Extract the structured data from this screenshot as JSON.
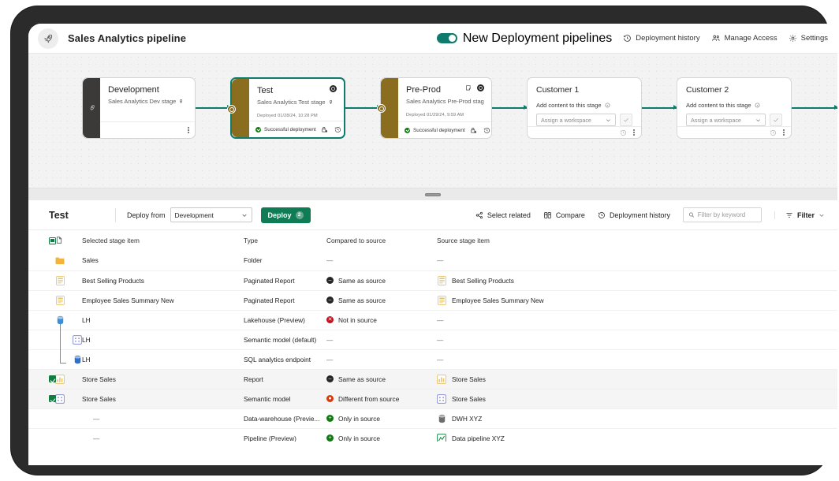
{
  "appbar": {
    "title": "Sales Analytics pipeline",
    "logo_icon": "rocket-icon",
    "toggle_label": "New Deployment pipelines",
    "toggle_on": true,
    "items": [
      {
        "label": "Deployment history",
        "icon": "history-icon"
      },
      {
        "label": "Manage Access",
        "icon": "people-icon"
      },
      {
        "label": "Settings",
        "icon": "gear-icon"
      }
    ]
  },
  "pipeline": {
    "stages": [
      {
        "name": "Development",
        "workspace": "Sales Analytics Dev stage",
        "side_color": "#3b3a39",
        "type": "deployed-plain",
        "kebab": "more-options-icon"
      },
      {
        "name": "Test",
        "workspace": "Sales Analytics Test stage",
        "side_color": "#8a6d1f",
        "type": "deployed",
        "deployed": "Deployed 01/28/24, 10:28 PM",
        "status": "Successful deployment",
        "selected": true
      },
      {
        "name": "Pre-Prod",
        "workspace": "Sales Analytics Pre-Prod stage",
        "side_color": "#8a6d1f",
        "type": "deployed",
        "deployed": "Deployed 01/29/24, 9:59 AM",
        "status": "Successful deployment",
        "selected": false
      },
      {
        "name": "Customer 1",
        "type": "empty",
        "add_label": "Add content to this stage",
        "workspace_placeholder": "Assign a workspace"
      },
      {
        "name": "Customer 2",
        "type": "empty",
        "add_label": "Add content to this stage",
        "workspace_placeholder": "Assign a workspace"
      }
    ]
  },
  "detail": {
    "stage_name": "Test",
    "deploy_from_label": "Deploy from",
    "deploy_from_value": "Development",
    "deploy_button": "Deploy",
    "deploy_count": "2",
    "tools": [
      {
        "label": "Select related",
        "icon": "share-related-icon"
      },
      {
        "label": "Compare",
        "icon": "compare-icon"
      },
      {
        "label": "Deployment history",
        "icon": "history-icon"
      }
    ],
    "search_placeholder": "Filter by keyword",
    "search_value": "",
    "filter_label": "Filter"
  },
  "table": {
    "headers": [
      "",
      "",
      "Selected stage item",
      "Type",
      "Compared to source",
      "Source stage item"
    ],
    "header_checkbox": "indeterminate",
    "rows": [
      {
        "checked": false,
        "show_check": false,
        "icon": "folder-icon",
        "icon_color": "#f2b43c",
        "name": "Sales",
        "indent": 0,
        "type": "Folder",
        "compare": "—",
        "compare_state": "none",
        "source": "—",
        "source_icon": null
      },
      {
        "checked": false,
        "show_check": false,
        "icon": "paginated-report-icon",
        "icon_color": "#e8c468",
        "name": "Best Selling Products",
        "indent": 0,
        "type": "Paginated Report",
        "compare": "Same as source",
        "compare_state": "same",
        "source": "Best Selling Products",
        "source_icon": "paginated-report-icon"
      },
      {
        "checked": false,
        "show_check": false,
        "icon": "paginated-report-icon",
        "icon_color": "#e8c468",
        "name": "Employee Sales Summary New",
        "indent": 0,
        "type": "Paginated Report",
        "compare": "Same as source",
        "compare_state": "same",
        "source": "Employee Sales Summary New",
        "source_icon": "paginated-report-icon"
      },
      {
        "checked": false,
        "show_check": false,
        "icon": "lakehouse-icon",
        "icon_color": "#3a8fd8",
        "name": "LH",
        "indent": 0,
        "type": "Lakehouse (Preview)",
        "compare": "Not in source",
        "compare_state": "notin",
        "source": "—",
        "source_icon": null
      },
      {
        "checked": false,
        "show_check": false,
        "icon": "semantic-model-icon",
        "icon_color": "#8b8fd6",
        "name": "LH",
        "indent": 1,
        "tree": "v",
        "type": "Semantic model (default)",
        "compare": "—",
        "compare_state": "none",
        "source": "—",
        "source_icon": null
      },
      {
        "checked": false,
        "show_check": false,
        "icon": "sql-endpoint-icon",
        "icon_color": "#2f6fd0",
        "name": "LH",
        "indent": 1,
        "tree": "l",
        "type": "SQL analytics endpoint",
        "compare": "—",
        "compare_state": "none",
        "source": "—",
        "source_icon": null
      },
      {
        "checked": true,
        "show_check": true,
        "icon": "report-icon",
        "icon_color": "#e8c468",
        "name": "Store Sales",
        "indent": 0,
        "selected": true,
        "type": "Report",
        "compare": "Same as source",
        "compare_state": "same",
        "source": "Store Sales",
        "source_icon": "report-icon"
      },
      {
        "checked": true,
        "show_check": true,
        "icon": "semantic-model-icon",
        "icon_color": "#8b8fd6",
        "name": "Store Sales",
        "indent": 0,
        "selected": true,
        "type": "Semantic model",
        "compare": "Different from source",
        "compare_state": "diff",
        "source": "Store Sales",
        "source_icon": "semantic-model-icon"
      },
      {
        "checked": false,
        "show_check": false,
        "icon": null,
        "icon_color": null,
        "name": "—",
        "indent": 0,
        "type": "Data-warehouse (Previe...",
        "compare": "Only in source",
        "compare_state": "only",
        "source": "DWH XYZ",
        "source_icon": "warehouse-icon"
      },
      {
        "checked": false,
        "show_check": false,
        "icon": null,
        "icon_color": null,
        "name": "—",
        "indent": 0,
        "type": "Pipeline (Preview)",
        "compare": "Only in source",
        "compare_state": "only",
        "source": "Data pipeline XYZ",
        "source_icon": "pipeline-icon"
      }
    ]
  },
  "colors": {
    "accent_green": "#107c56",
    "connector_green": "#0f7b6c",
    "stage_gold": "#8a6d1f",
    "status_same": "#262626",
    "status_diff": "#d63b0a",
    "status_notin": "#c50f1f",
    "status_only": "#0f7b0f"
  }
}
